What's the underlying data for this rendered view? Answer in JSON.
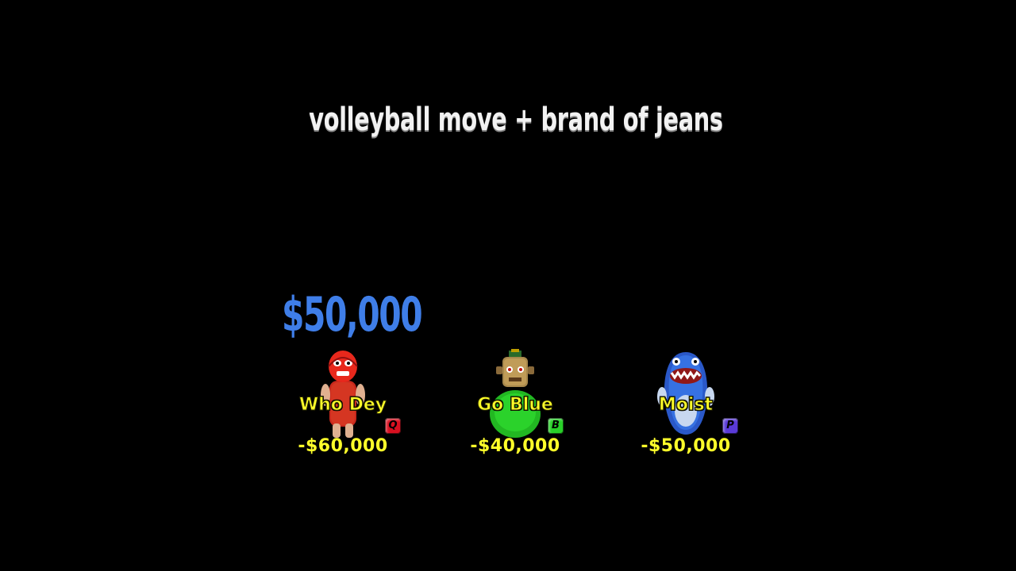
{
  "clue": "volleyball move + brand of jeans",
  "pot": "$50,000",
  "players": [
    {
      "name": "Who Dey",
      "key": "Q",
      "score": "-$60,000",
      "key_color": "#d81020",
      "avatar": "red-wrestler-mask-doll-icon"
    },
    {
      "name": "Go Blue",
      "key": "B",
      "score": "-$40,000",
      "key_color": "#28d028",
      "avatar": "green-robot-doll-icon"
    },
    {
      "name": "Moist",
      "key": "P",
      "score": "-$50,000",
      "key_color": "#5a3ad8",
      "avatar": "blue-grinning-shark-icon"
    }
  ]
}
